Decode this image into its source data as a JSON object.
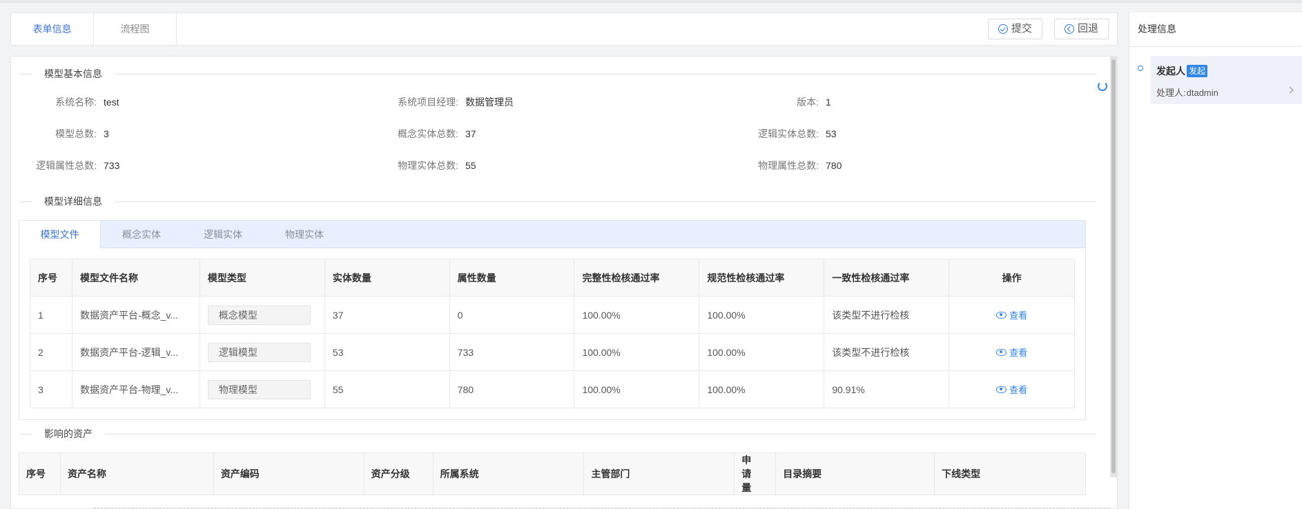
{
  "tabs": [
    "表单信息",
    "流程图"
  ],
  "actions": {
    "submit": "提交",
    "back": "回退"
  },
  "basic": {
    "title": "模型基本信息",
    "fields": {
      "sys_name_label": "系统名称:",
      "sys_name": "test",
      "manager_label": "系统项目经理:",
      "manager": "数据管理员",
      "version_label": "版本:",
      "version": "1",
      "model_total_label": "模型总数:",
      "model_total": "3",
      "concept_total_label": "概念实体总数:",
      "concept_total": "37",
      "logic_total_label": "逻辑实体总数:",
      "logic_total": "53",
      "logic_attr_label": "逻辑属性总数:",
      "logic_attr": "733",
      "phys_total_label": "物理实体总数:",
      "phys_total": "55",
      "phys_attr_label": "物理属性总数:",
      "phys_attr": "780"
    }
  },
  "detail": {
    "title": "模型详细信息",
    "subtabs": [
      "模型文件",
      "概念实体",
      "逻辑实体",
      "物理实体"
    ],
    "columns": [
      "序号",
      "模型文件名称",
      "模型类型",
      "实体数量",
      "属性数量",
      "完整性检核通过率",
      "规范性检核通过率",
      "一致性检核通过率",
      "操作"
    ],
    "rows": [
      {
        "no": "1",
        "name": "数据资产平台-概念_v...",
        "type": "概念模型",
        "entities": "37",
        "attrs": "0",
        "integrity": "100.00%",
        "norm": "100.00%",
        "consistency": "该类型不进行检核",
        "action": "查看"
      },
      {
        "no": "2",
        "name": "数据资产平台-逻辑_v...",
        "type": "逻辑模型",
        "entities": "53",
        "attrs": "733",
        "integrity": "100.00%",
        "norm": "100.00%",
        "consistency": "该类型不进行检核",
        "action": "查看"
      },
      {
        "no": "3",
        "name": "数据资产平台-物理_v...",
        "type": "物理模型",
        "entities": "55",
        "attrs": "780",
        "integrity": "100.00%",
        "norm": "100.00%",
        "consistency": "90.91%",
        "action": "查看"
      }
    ]
  },
  "assets": {
    "title": "影响的资产",
    "columns": [
      "序号",
      "资产名称",
      "资产编码",
      "资产分级",
      "所属系统",
      "主管部门",
      "申请量",
      "目录摘要",
      "下线类型"
    ]
  },
  "process": {
    "title": "处理信息",
    "node_name": "发起人",
    "node_badge": "发起",
    "handler_label": "处理人:",
    "handler": "dtadmin"
  }
}
